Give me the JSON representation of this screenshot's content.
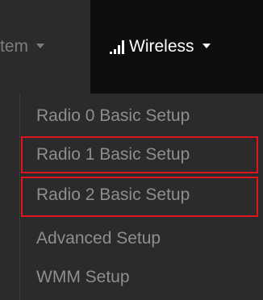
{
  "navbar": {
    "system_label": "tem",
    "wireless_label": "Wireless"
  },
  "dropdown": {
    "items": [
      {
        "label": "Radio 0 Basic Setup"
      },
      {
        "label": "Radio 1 Basic Setup"
      },
      {
        "label": "Radio 2 Basic Setup"
      },
      {
        "label": "Advanced Setup"
      },
      {
        "label": "WMM Setup"
      }
    ]
  },
  "colors": {
    "navbar_bg": "#2b2b2b",
    "active_tab_bg": "#0e0e0e",
    "menu_text": "#8e8e8e",
    "highlight": "#e0141e"
  }
}
